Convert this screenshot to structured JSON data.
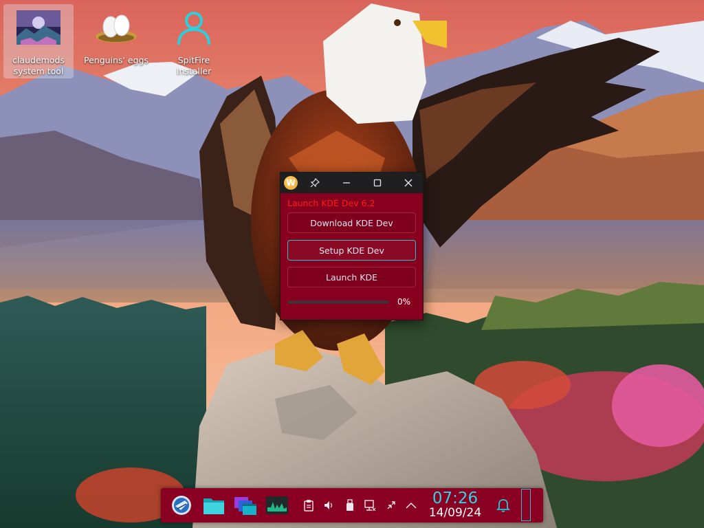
{
  "desktop": {
    "icons": [
      {
        "label": "claudemods system tool",
        "icon": "landscape-thumbnail-icon",
        "selected": true
      },
      {
        "label": "Penguins' eggs",
        "icon": "eggs-nest-icon",
        "selected": false
      },
      {
        "label": "SpitFire Installer",
        "icon": "user-outline-icon",
        "selected": false
      }
    ]
  },
  "window": {
    "app_icon_letter": "W",
    "heading": "Launch KDE Dev 6.2",
    "buttons": {
      "download": "Download KDE Dev",
      "setup": "Setup KDE Dev",
      "launch": "Launch KDE"
    },
    "progress": {
      "value": 0,
      "text": "0%"
    },
    "colors": {
      "background": "#87001e",
      "heading": "#ff1c1c",
      "accent": "#2ac3d3"
    }
  },
  "taskbar": {
    "launchers": [
      "app-launcher-icon",
      "file-manager-icon",
      "window-switcher-icon",
      "system-monitor-icon"
    ],
    "tray": [
      "clipboard-icon",
      "volume-icon",
      "usb-drive-icon",
      "network-icon",
      "updates-icon",
      "tray-expand-icon"
    ],
    "clock": {
      "time": "07:26",
      "date": "14/09/24"
    },
    "colors": {
      "panel": "#8a0022",
      "clock": "#36d2e0"
    }
  }
}
